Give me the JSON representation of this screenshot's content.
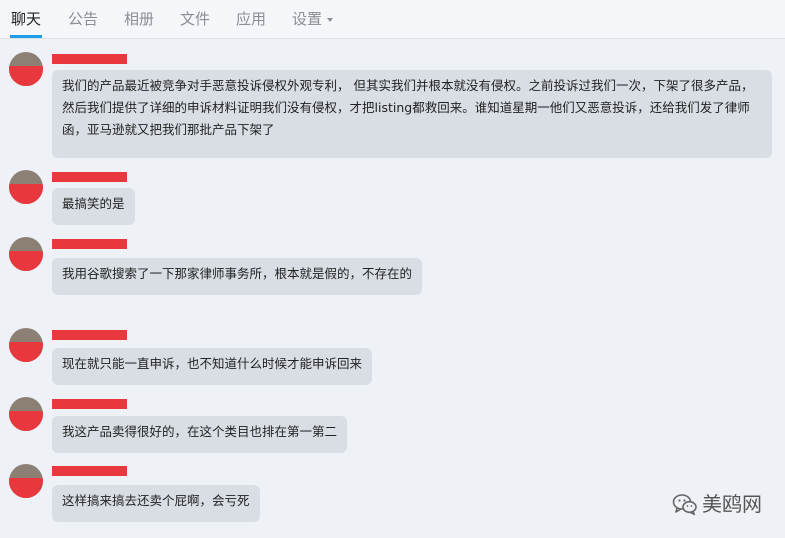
{
  "tabs": [
    {
      "label": "聊天"
    },
    {
      "label": "公告"
    },
    {
      "label": "相册"
    },
    {
      "label": "文件"
    },
    {
      "label": "应用"
    },
    {
      "label": "设置"
    }
  ],
  "messages": [
    {
      "text": "我们的产品最近被竞争对手恶意投诉侵权外观专利， 但其实我们并根本就没有侵权。之前投诉过我们一次，下架了很多产品，然后我们提供了详细的申诉材料证明我们没有侵权，才把listing都救回来。谁知道星期一他们又恶意投诉，还给我们发了律师函，亚马逊就又把我们那批产品下架了"
    },
    {
      "text": "最搞笑的是"
    },
    {
      "text": "我用谷歌搜索了一下那家律师事务所，根本就是假的，不存在的"
    },
    {
      "text": "现在就只能一直申诉，也不知道什么时候才能申诉回来"
    },
    {
      "text": "我这产品卖得很好的，在这个类目也排在第一第二"
    },
    {
      "text": "这样搞来搞去还卖个屁啊，会亏死"
    }
  ],
  "watermark": {
    "text": "美鸥网",
    "icon": "wechat-icon"
  },
  "colors": {
    "accent": "#1f9ee8",
    "redaction": "#e8383d",
    "bubble": "#d9dee5"
  }
}
